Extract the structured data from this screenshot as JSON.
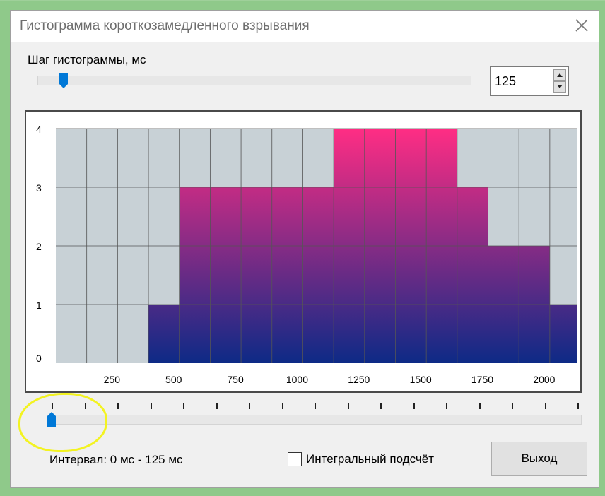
{
  "window": {
    "title": "Гистограмма короткозамедленного взрывания"
  },
  "step": {
    "label": "Шаг гистограммы, мс",
    "value": "125",
    "slider_fraction": 0.05
  },
  "interval": {
    "slider_fraction": 0.0,
    "text": "Интервал:  0 мс - 125 мс"
  },
  "integral_checkbox": {
    "label": "Интегральный подсчёт",
    "checked": false
  },
  "exit_button": {
    "label": "Выход"
  },
  "colors": {
    "bar_top": "#ff2d84",
    "bar_bottom": "#0d2a86",
    "plot_bg": "#c8d1d6",
    "accent": "#0078d7"
  },
  "chart_data": {
    "type": "bar",
    "title": "",
    "xlabel": "",
    "ylabel": "",
    "bin_ms": 125,
    "bin_starts": [
      0,
      125,
      250,
      375,
      500,
      625,
      750,
      875,
      1000,
      1125,
      1250,
      1375,
      1500,
      1625,
      1750,
      1875,
      2000
    ],
    "values": [
      0,
      0,
      0,
      1,
      3,
      3,
      3,
      3,
      3,
      4,
      4,
      4,
      4,
      3,
      2,
      2,
      1
    ],
    "xlim": [
      0,
      2112
    ],
    "ylim": [
      0,
      4
    ],
    "x_ticks": [
      "250",
      "500",
      "750",
      "1000",
      "1250",
      "1500",
      "1750",
      "2000"
    ],
    "x_tick_values": [
      250,
      500,
      750,
      1000,
      1250,
      1500,
      1750,
      2000
    ],
    "y_ticks": [
      "0",
      "1",
      "2",
      "3",
      "4"
    ],
    "y_tick_values": [
      0,
      1,
      2,
      3,
      4
    ],
    "grid": true
  }
}
